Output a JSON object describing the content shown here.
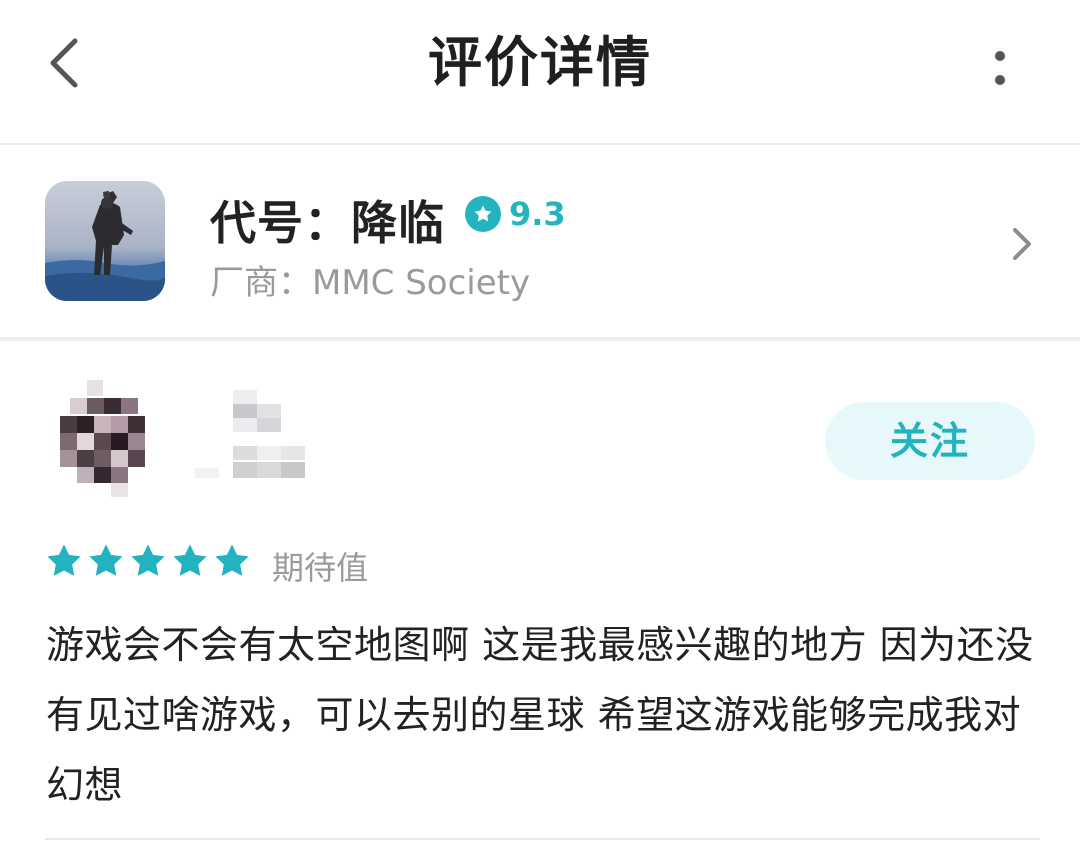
{
  "header": {
    "title": "评价详情",
    "back_icon": "chevron-left-icon",
    "more_icon": "more-vertical-icon"
  },
  "game": {
    "name": "代号：降临",
    "rating": "9.3",
    "vendor": "厂商：MMC Society",
    "rating_color": "#24b3c0"
  },
  "review": {
    "follow_label": "关注",
    "stars": 5,
    "expect_label": "期待值",
    "text": "游戏会不会有太空地图啊 这是我最感兴趣的地方 因为还没有见过啥游戏，可以去别的星球 希望这游戏能够完成我对幻想",
    "accent": "#22b2c0"
  }
}
